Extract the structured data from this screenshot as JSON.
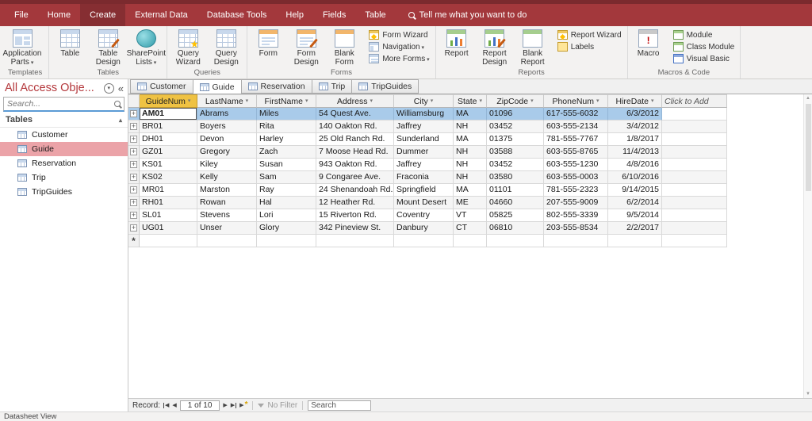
{
  "titlebar": {
    "tabs": [
      {
        "label": "File",
        "active": false
      },
      {
        "label": "Home",
        "active": false
      },
      {
        "label": "Create",
        "active": true
      },
      {
        "label": "External Data",
        "active": false
      },
      {
        "label": "Database Tools",
        "active": false
      },
      {
        "label": "Help",
        "active": false
      },
      {
        "label": "Fields",
        "active": false
      },
      {
        "label": "Table",
        "active": false
      }
    ],
    "tell_me": "Tell me what you want to do"
  },
  "ribbon": {
    "groups": [
      {
        "label": "Templates",
        "buttons": [
          {
            "label": "Application Parts",
            "icon": "app-parts",
            "size": "large",
            "dropdown": true
          }
        ]
      },
      {
        "label": "Tables",
        "buttons": [
          {
            "label": "Table",
            "icon": "table",
            "size": "large"
          },
          {
            "label": "Table Design",
            "icon": "table-design",
            "size": "large"
          },
          {
            "label": "SharePoint Lists",
            "icon": "sharepoint",
            "size": "large",
            "dropdown": true
          }
        ]
      },
      {
        "label": "Queries",
        "buttons": [
          {
            "label": "Query Wizard",
            "icon": "query-wizard",
            "size": "large"
          },
          {
            "label": "Query Design",
            "icon": "query-design",
            "size": "large"
          }
        ]
      },
      {
        "label": "Forms",
        "buttons": [
          {
            "label": "Form",
            "icon": "form",
            "size": "large"
          },
          {
            "label": "Form Design",
            "icon": "form-design",
            "size": "large"
          },
          {
            "label": "Blank Form",
            "icon": "blank-form",
            "size": "large"
          },
          {
            "label": "Form Wizard",
            "icon": "wizard",
            "size": "small"
          },
          {
            "label": "Navigation",
            "icon": "navigation",
            "size": "small",
            "dropdown": true
          },
          {
            "label": "More Forms",
            "icon": "more-forms",
            "size": "small",
            "dropdown": true
          }
        ]
      },
      {
        "label": "Reports",
        "buttons": [
          {
            "label": "Report",
            "icon": "report",
            "size": "large"
          },
          {
            "label": "Report Design",
            "icon": "report-design",
            "size": "large"
          },
          {
            "label": "Blank Report",
            "icon": "blank-report",
            "size": "large"
          },
          {
            "label": "Report Wizard",
            "icon": "report-wizard",
            "size": "small"
          },
          {
            "label": "Labels",
            "icon": "labels",
            "size": "small"
          }
        ]
      },
      {
        "label": "Macros & Code",
        "buttons": [
          {
            "label": "Macro",
            "icon": "macro",
            "size": "large"
          },
          {
            "label": "Module",
            "icon": "module",
            "size": "small"
          },
          {
            "label": "Class Module",
            "icon": "class-module",
            "size": "small"
          },
          {
            "label": "Visual Basic",
            "icon": "visual-basic",
            "size": "small"
          }
        ]
      }
    ]
  },
  "sidebar": {
    "title": "All Access Obje...",
    "search_placeholder": "Search...",
    "group_label": "Tables",
    "items": [
      {
        "label": "Customer",
        "selected": false
      },
      {
        "label": "Guide",
        "selected": true
      },
      {
        "label": "Reservation",
        "selected": false
      },
      {
        "label": "Trip",
        "selected": false
      },
      {
        "label": "TripGuides",
        "selected": false
      }
    ]
  },
  "document_tabs": [
    {
      "label": "Customer",
      "active": false
    },
    {
      "label": "Guide",
      "active": true
    },
    {
      "label": "Reservation",
      "active": false
    },
    {
      "label": "Trip",
      "active": false
    },
    {
      "label": "TripGuides",
      "active": false
    }
  ],
  "table": {
    "columns": [
      {
        "label": "GuideNum",
        "selected": true
      },
      {
        "label": "LastName"
      },
      {
        "label": "FirstName"
      },
      {
        "label": "Address"
      },
      {
        "label": "City"
      },
      {
        "label": "State"
      },
      {
        "label": "ZipCode"
      },
      {
        "label": "PhoneNum"
      },
      {
        "label": "HireDate"
      },
      {
        "label": "Click to Add",
        "add": true
      }
    ],
    "rows": [
      [
        "AM01",
        "Abrams",
        "Miles",
        "54 Quest Ave.",
        "Williamsburg",
        "MA",
        "01096",
        "617-555-6032",
        "6/3/2012"
      ],
      [
        "BR01",
        "Boyers",
        "Rita",
        "140 Oakton Rd.",
        "Jaffrey",
        "NH",
        "03452",
        "603-555-2134",
        "3/4/2012"
      ],
      [
        "DH01",
        "Devon",
        "Harley",
        "25 Old Ranch Rd.",
        "Sunderland",
        "MA",
        "01375",
        "781-555-7767",
        "1/8/2017"
      ],
      [
        "GZ01",
        "Gregory",
        "Zach",
        "7 Moose Head Rd.",
        "Dummer",
        "NH",
        "03588",
        "603-555-8765",
        "11/4/2013"
      ],
      [
        "KS01",
        "Kiley",
        "Susan",
        "943 Oakton Rd.",
        "Jaffrey",
        "NH",
        "03452",
        "603-555-1230",
        "4/8/2016"
      ],
      [
        "KS02",
        "Kelly",
        "Sam",
        "9 Congaree Ave.",
        "Fraconia",
        "NH",
        "03580",
        "603-555-0003",
        "6/10/2016"
      ],
      [
        "MR01",
        "Marston",
        "Ray",
        "24 Shenandoah Rd.",
        "Springfield",
        "MA",
        "01101",
        "781-555-2323",
        "9/14/2015"
      ],
      [
        "RH01",
        "Rowan",
        "Hal",
        "12 Heather Rd.",
        "Mount Desert",
        "ME",
        "04660",
        "207-555-9009",
        "6/2/2014"
      ],
      [
        "SL01",
        "Stevens",
        "Lori",
        "15 Riverton Rd.",
        "Coventry",
        "VT",
        "05825",
        "802-555-3339",
        "9/5/2014"
      ],
      [
        "UG01",
        "Unser",
        "Glory",
        "342 Pineview St.",
        "Danbury",
        "CT",
        "06810",
        "203-555-8534",
        "2/2/2017"
      ]
    ],
    "selected_row_index": 0,
    "current_cell": {
      "row": 0,
      "col": 0
    },
    "new_row_marker": "*"
  },
  "record_nav": {
    "label": "Record:",
    "position": "1 of 10",
    "no_filter_label": "No Filter",
    "search_placeholder": "Search"
  },
  "status_bar": {
    "left": "Datasheet View"
  },
  "colors": {
    "titlebar_red": "#A3383C",
    "active_tab_red": "#862E32",
    "selected_row_blue": "#A9CBEA",
    "selected_column_gold": "#EFC243",
    "nav_selected_pink": "#EBA3A8"
  }
}
